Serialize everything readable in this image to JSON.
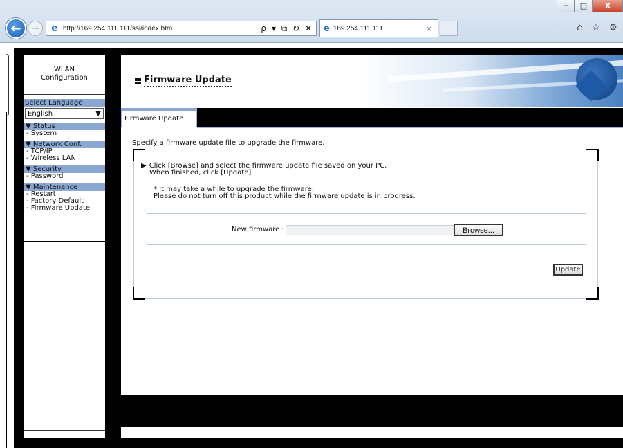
{
  "browser": {
    "url": "http://169.254.111.111/ssi/index.htm",
    "address_tools": "ρ ▾ ⧉ ↻ ✕",
    "tab_title": "169.254.111.111",
    "tab_close": "×",
    "favorites_icons": "⌂ ☆ ⚙",
    "window_controls": {
      "minimize": "─",
      "maximize": "□",
      "close": "X"
    }
  },
  "sidebar": {
    "title_line1": "WLAN",
    "title_line2": "Configuration",
    "select_language_label": "Select Language",
    "language_value": "English",
    "groups": [
      {
        "label": "▼ Status",
        "items": [
          "- System"
        ]
      },
      {
        "label": "▼ Network Conf.",
        "items": [
          "- TCP/IP",
          "- Wireless LAN"
        ]
      },
      {
        "label": "▼ Security",
        "items": [
          "- Password"
        ]
      },
      {
        "label": "▼ Maintenance",
        "items": [
          "- Restart",
          "- Factory Default",
          "- Firmware Update"
        ]
      }
    ]
  },
  "main": {
    "page_title": "Firmware Update",
    "tab_label": "Firmware Update",
    "intro": "Specify a firmware update file to upgrade the firmware.",
    "instruction_line1": "Click [Browse] and select the firmware update file saved on your PC.",
    "instruction_line2": "When finished, click [Update].",
    "note_line1": "* It may take a while to upgrade the firmware.",
    "note_line2": "Please do not turn off this product while the firmware update is in progress.",
    "new_firmware_label": "New firmware :",
    "new_firmware_value": "",
    "browse_label": "Browse...",
    "update_label": "Update"
  }
}
